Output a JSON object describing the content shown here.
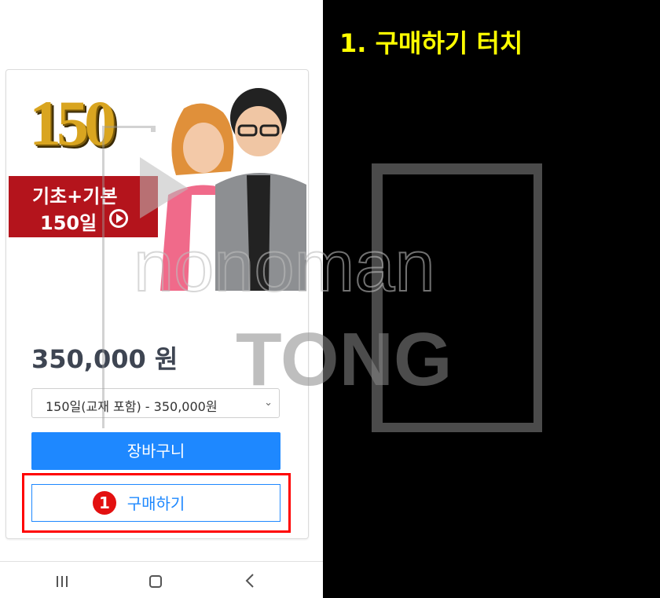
{
  "banner": {
    "logo_text": "150",
    "ribbon_line1": "기초+기본",
    "ribbon_line2": "150일"
  },
  "product": {
    "price": "350,000 원",
    "select_value": "150일(교재 포함) - 350,000원",
    "cart_label": "장바구니",
    "buy_label": "구매하기"
  },
  "annotation": {
    "step_number": "1",
    "instruction": "1. 구매하기 터치"
  },
  "watermark": {
    "line1": "nonoman",
    "line2": "TONG"
  },
  "nav": {
    "icons": [
      "recent-apps-icon",
      "home-icon",
      "back-icon"
    ]
  },
  "colors": {
    "accent": "#1e88ff",
    "highlight": "#ff0000",
    "instruction_text": "#ffff00",
    "ribbon": "#b4141c"
  }
}
